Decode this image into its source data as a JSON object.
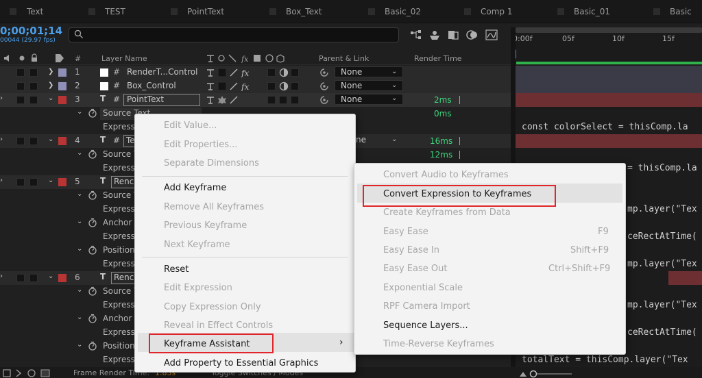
{
  "tabs": [
    "Text",
    "TEST",
    "PointText",
    "Box_Text",
    "Basic_02",
    "Comp 1",
    "Basic_01",
    "Basic"
  ],
  "timecode": "0;00;01;14",
  "fps_info": "00044 (29.97 fps)",
  "column_headers": {
    "number": "#",
    "layer_name": "Layer Name",
    "parent_link": "Parent & Link",
    "render_time": "Render Time"
  },
  "ruler_ticks": [
    "0:00f",
    "05f",
    "10f",
    "15f"
  ],
  "layers": [
    {
      "number": "1",
      "name": "RenderT...Control",
      "parent": "None",
      "label_color": "#8f8fb8",
      "type": "null"
    },
    {
      "number": "2",
      "name": "Box_Control",
      "parent": "None",
      "label_color": "#8f8fb8",
      "type": "null"
    },
    {
      "number": "3",
      "name": "PointText",
      "parent": "None",
      "label_color": "#b93535",
      "render_time": "2ms",
      "type": "text"
    },
    {
      "number": "4",
      "name": "Te",
      "parent": "ne",
      "label_color": "#b93535",
      "render_time": "16ms",
      "type": "text"
    },
    {
      "number": "5",
      "name": "Renc",
      "label_color": "#b93535",
      "type": "text"
    },
    {
      "number": "6",
      "name": "Renc",
      "label_color": "#b93535",
      "type": "text"
    }
  ],
  "properties": {
    "source_text": "Source Text",
    "source_text_short": "Source T",
    "expression": "Expressi",
    "anchor": "Anchor",
    "position": "Position",
    "zero_ms": "0ms",
    "twelve_ms": "12ms"
  },
  "code_lines": {
    "line1": "const colorSelect = thisComp.la",
    "line2": "= thisComp.la",
    "line3": "mp.layer(\"Tex",
    "line4": "ceRectAtTime(",
    "line5": "mp.layer(\"Tex",
    "line6": "mp.layer(\"Tex",
    "line7": "ceRectAtTime(",
    "line8": "totalText = thisComp.layer(\"Tex"
  },
  "main_menu": {
    "edit_value": "Edit Value...",
    "edit_properties": "Edit Properties...",
    "separate_dimensions": "Separate Dimensions",
    "add_keyframe": "Add Keyframe",
    "remove_all_keyframes": "Remove All Keyframes",
    "previous_keyframe": "Previous Keyframe",
    "next_keyframe": "Next Keyframe",
    "reset": "Reset",
    "edit_expression": "Edit Expression",
    "copy_expression_only": "Copy Expression Only",
    "reveal_in_effect_controls": "Reveal in Effect Controls",
    "keyframe_assistant": "Keyframe Assistant",
    "add_property_essential": "Add Property to Essential Graphics",
    "submenu_arrow": "›"
  },
  "sub_menu": {
    "convert_audio": "Convert Audio to Keyframes",
    "convert_expression": "Convert Expression to Keyframes",
    "create_from_data": "Create Keyframes from Data",
    "easy_ease": "Easy Ease",
    "easy_ease_shortcut": "F9",
    "easy_ease_in": "Easy Ease In",
    "easy_ease_in_shortcut": "Shift+F9",
    "easy_ease_out": "Easy Ease Out",
    "easy_ease_out_shortcut": "Ctrl+Shift+F9",
    "exponential_scale": "Exponential Scale",
    "rpf_camera_import": "RPF Camera Import",
    "sequence_layers": "Sequence Layers...",
    "time_reverse": "Time-Reverse Keyframes"
  },
  "footer": {
    "frame_render_label": "Frame Render Time:",
    "frame_render_value": "1.83s",
    "toggle_switches": "Toggle Switches / Modes"
  },
  "colors": {
    "accent_blue": "#4a9eea",
    "render_green": "#3ed67b",
    "highlight_red": "#e0262a",
    "work_area_green": "#2fb34a"
  }
}
